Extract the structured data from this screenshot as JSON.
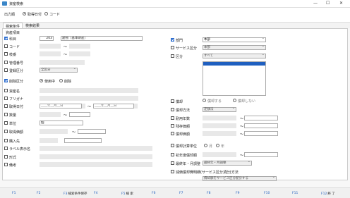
{
  "window": {
    "title": "資産検索",
    "minimize": "—",
    "maximize": "☐",
    "close": "✕"
  },
  "topbar": {
    "label": "出力順",
    "opt1": "取得日付",
    "opt2": "コード"
  },
  "tabs": [
    "検索条件",
    "検索結果"
  ],
  "section_title": "資産項目",
  "left": {
    "kamoku": {
      "label": "科目",
      "code": "203",
      "name": "建物（基本財産）"
    },
    "code": {
      "label": "コード",
      "tilde": "〜"
    },
    "shikan": {
      "label": "枝番",
      "tilde": "〜"
    },
    "kanri": {
      "label": "管理番号"
    },
    "touroku": {
      "label": "登録区分",
      "value": "全区分"
    },
    "sakujo": {
      "label": "削除区分",
      "opt1": "使用中",
      "opt2": "削除"
    },
    "shisanmei": {
      "label": "資産名"
    },
    "furigana": {
      "label": "フリガナ"
    },
    "shutoku": {
      "label": "取得日付",
      "from": "____年__月__日",
      "to": "____年__月__日",
      "tilde": "〜"
    },
    "suryo": {
      "label": "数量",
      "tilde": "〜"
    },
    "tani": {
      "label": "単位",
      "value": "個"
    },
    "kagaku": {
      "label": "取得価額",
      "tilde": "〜"
    },
    "konyu": {
      "label": "購入先"
    },
    "label": {
      "label": "ラベル表示名"
    },
    "keishiki": {
      "label": "形式"
    },
    "biko": {
      "label": "備考"
    }
  },
  "right": {
    "bumon": {
      "label": "部門",
      "value": "本部"
    },
    "service": {
      "label": "サービス区分",
      "value": "本部"
    },
    "kubun": {
      "label": "区分",
      "value": "すべて"
    },
    "shokyaku": {
      "label": "償却",
      "opt1": "償却する",
      "opt2": "償却しない"
    },
    "hoho": {
      "label": "償却方法",
      "value": "定額法"
    },
    "nensu": {
      "label": "耐用年数",
      "tilde": "〜"
    },
    "zanson": {
      "label": "残存価額",
      "tilde": "〜"
    },
    "hosyo": {
      "label": "償却価額",
      "tilde": "〜"
    },
    "keisan": {
      "label": "償却計算単位",
      "opt1": "月",
      "opt2": "年"
    },
    "shonen": {
      "label": "初年度償却額",
      "tilde": "〜"
    },
    "saishu": {
      "label": "最終年・月調整",
      "value": "最終年・月調整"
    },
    "genka": {
      "label": "減価償却費明細(サービス区分)配分方法",
      "value": "償却額をサービス区分配分する"
    }
  },
  "footer": [
    {
      "key": "F1",
      "label": ""
    },
    {
      "key": "F2",
      "label": ""
    },
    {
      "key": "F3",
      "label": "検索条件保存"
    },
    {
      "key": "F4",
      "label": ""
    },
    {
      "key": "F5",
      "label": "検 索"
    },
    {
      "key": "F6",
      "label": ""
    },
    {
      "key": "F7",
      "label": ""
    },
    {
      "key": "F8",
      "label": ""
    },
    {
      "key": "F9",
      "label": ""
    },
    {
      "key": "F10",
      "label": ""
    },
    {
      "key": "F11",
      "label": ""
    },
    {
      "key": "F12",
      "label": "終 了"
    }
  ],
  "colors": {
    "accent": "#2f6fd0",
    "list_selected": "#1f5fbf"
  }
}
